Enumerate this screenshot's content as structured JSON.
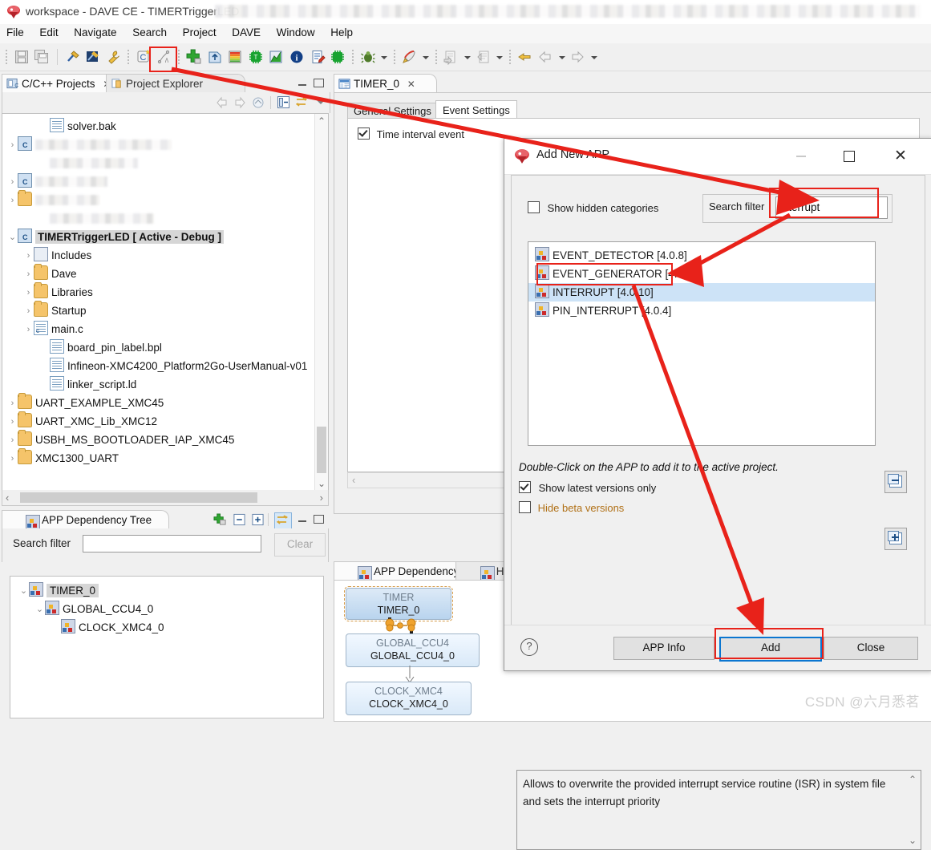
{
  "window": {
    "title": "workspace - DAVE CE - TIMERTriggerLED",
    "app_icon": "dave-icon"
  },
  "menubar": {
    "items": [
      "File",
      "Edit",
      "Navigate",
      "Search",
      "Project",
      "DAVE",
      "Window",
      "Help"
    ]
  },
  "toolbar": {
    "groups": [
      {
        "icons": [
          "save-icon",
          "save-all-icon"
        ]
      },
      {
        "icons": [
          "build-hammer-icon",
          "build-all-icon",
          "wrench-icon"
        ]
      },
      {
        "icons": [
          "new-ce-icon",
          "manual-pin-icon"
        ]
      },
      {
        "icons": [
          "add-new-app-icon",
          "import-app-icon",
          "resource-bar-icon",
          "chip-green-icon",
          "solver-icon",
          "info-icon",
          "report-icon",
          "device-icon"
        ]
      },
      {
        "icons": [
          "debug-bug-icon"
        ],
        "dropdown": true
      },
      {
        "icons": [
          "run-rocket-icon"
        ],
        "dropdown": true
      },
      {
        "icons": [
          "external-tools-icon"
        ],
        "dropdown": true
      },
      {
        "icons": [
          "open-type-icon"
        ],
        "dropdown": true
      },
      {
        "icons": [
          "last-edit-icon"
        ]
      },
      {
        "icons": [
          "back-icon"
        ],
        "dropdown": true
      },
      {
        "icons": [
          "forward-icon"
        ],
        "dropdown": true
      }
    ]
  },
  "projects_view": {
    "tabs": [
      {
        "label": "C/C++ Projects",
        "icon": "cpp-projects-icon",
        "active": true,
        "closable": true
      },
      {
        "label": "Project Explorer",
        "icon": "project-explorer-icon",
        "active": false,
        "closable": false
      }
    ],
    "toolbar_icons": [
      "back-arrow-icon",
      "forward-arrow-icon",
      "home-icon",
      "collapse-all-icon",
      "link-with-editor-icon",
      "view-menu-icon"
    ],
    "view_buttons": [
      "minimize-icon",
      "maximize-icon"
    ],
    "tree": [
      {
        "label": "solver.bak",
        "icon": "file-icon",
        "indent": 2,
        "twisty": "",
        "redacted": false
      },
      {
        "label": "",
        "icon": "project-icon",
        "indent": 0,
        "twisty": "collapsed",
        "redacted": true,
        "blur_width": 170
      },
      {
        "label": "",
        "icon": "none",
        "indent": 1,
        "twisty": "",
        "redacted": true,
        "blur_width": 110
      },
      {
        "label": "",
        "icon": "project-icon",
        "indent": 0,
        "twisty": "collapsed",
        "redacted": true,
        "blur_width": 90
      },
      {
        "label": "",
        "icon": "folder-icon",
        "indent": 0,
        "twisty": "collapsed",
        "redacted": true,
        "blur_width": 80
      },
      {
        "label": "",
        "icon": "none",
        "indent": 1,
        "twisty": "",
        "redacted": true,
        "blur_width": 130
      },
      {
        "label": "TIMERTriggerLED  [ Active - Debug ]",
        "icon": "project-icon",
        "indent": 0,
        "twisty": "expanded",
        "selected": true,
        "bold": true,
        "redacted": false
      },
      {
        "label": "Includes",
        "icon": "includes-icon",
        "indent": 1,
        "twisty": "collapsed"
      },
      {
        "label": "Dave",
        "icon": "folder-icon",
        "indent": 1,
        "twisty": "collapsed"
      },
      {
        "label": "Libraries",
        "icon": "folder-icon",
        "indent": 1,
        "twisty": "collapsed"
      },
      {
        "label": "Startup",
        "icon": "folder-icon",
        "indent": 1,
        "twisty": "collapsed"
      },
      {
        "label": "main.c",
        "icon": "c-file-icon",
        "indent": 1,
        "twisty": "collapsed"
      },
      {
        "label": "board_pin_label.bpl",
        "icon": "file-icon",
        "indent": 2,
        "twisty": ""
      },
      {
        "label": "Infineon-XMC4200_Platform2Go-UserManual-v01",
        "icon": "file-icon",
        "indent": 2,
        "twisty": ""
      },
      {
        "label": "linker_script.ld",
        "icon": "file-icon",
        "indent": 2,
        "twisty": ""
      },
      {
        "label": "UART_EXAMPLE_XMC45",
        "icon": "folder-icon",
        "indent": 0,
        "twisty": "collapsed"
      },
      {
        "label": "UART_XMC_Lib_XMC12",
        "icon": "folder-icon",
        "indent": 0,
        "twisty": "collapsed"
      },
      {
        "label": "USBH_MS_BOOTLOADER_IAP_XMC45",
        "icon": "folder-icon",
        "indent": 0,
        "twisty": "collapsed"
      },
      {
        "label": "XMC1300_UART",
        "icon": "folder-icon",
        "indent": 0,
        "twisty": "collapsed"
      }
    ]
  },
  "dependency_tree_view": {
    "tab_label": "APP Dependency Tree",
    "tab_icon": "app-icon",
    "toolbar_icons": [
      "add-new-app-icon",
      "collapse-all-icon",
      "expand-all-icon",
      "link-with-editor-icon",
      "minimize-icon",
      "maximize-icon"
    ],
    "search_label": "Search filter",
    "search_value": "",
    "search_placeholder": "",
    "clear_label": "Clear",
    "clear_enabled": false,
    "nodes": [
      {
        "label": "TIMER_0",
        "indent": 0,
        "twisty": "expanded",
        "selected": true
      },
      {
        "label": "GLOBAL_CCU4_0",
        "indent": 1,
        "twisty": "expanded",
        "selected": false
      },
      {
        "label": "CLOCK_XMC4_0",
        "indent": 2,
        "twisty": "",
        "selected": false
      }
    ]
  },
  "editor": {
    "tab_label": "TIMER_0",
    "tab_icon": "ce-editor-icon",
    "inner_tabs": [
      {
        "label": "General Settings",
        "active": false
      },
      {
        "label": "Event Settings",
        "active": true
      }
    ],
    "checkbox": {
      "label": "Time interval event",
      "checked": true
    }
  },
  "app_dependency_graph": {
    "tabs": [
      {
        "label": "APP Dependency",
        "icon": "app-icon",
        "active": true,
        "closable": true
      },
      {
        "label": "H",
        "icon": "app-icon",
        "active": false,
        "closable": false
      }
    ],
    "nodes": [
      {
        "type": "TIMER",
        "instance": "TIMER_0",
        "selected": true
      },
      {
        "type": "GLOBAL_CCU4",
        "instance": "GLOBAL_CCU4_0",
        "selected": false
      },
      {
        "type": "CLOCK_XMC4",
        "instance": "CLOCK_XMC4_0",
        "selected": false
      }
    ]
  },
  "dialog": {
    "title": "Add New APP",
    "icon": "dave-icon",
    "window_buttons": [
      "minimize-icon",
      "maximize-icon",
      "close-icon"
    ],
    "show_hidden_categories": {
      "label": "Show hidden categories",
      "checked": false
    },
    "search_filter_label": "Search filter",
    "search_filter_value": "Interrupt",
    "list_items": [
      {
        "label": "EVENT_DETECTOR [4.0.8]",
        "selected": false
      },
      {
        "label": "EVENT_GENERATOR [4.1.16]",
        "selected": false
      },
      {
        "label": "INTERRUPT [4.0.10]",
        "selected": true
      },
      {
        "label": "PIN_INTERRUPT [4.0.4]",
        "selected": false
      }
    ],
    "side_buttons": [
      "collapse-all-icon",
      "expand-all-icon"
    ],
    "hint": "Double-Click on the APP to add it to the active project.",
    "show_latest_versions": {
      "label": "Show latest versions only",
      "checked": true
    },
    "hide_beta_versions": {
      "label": "Hide beta versions",
      "checked": false,
      "color": "#b07016"
    },
    "description": "Allows to overwrite the provided interrupt service routine (ISR) in system file\n and sets the interrupt priority",
    "help_icon": "help-question-icon",
    "buttons": [
      {
        "label": "APP Info",
        "focused": false
      },
      {
        "label": "Add",
        "focused": true
      },
      {
        "label": "Close",
        "focused": false
      }
    ]
  },
  "annotations": {
    "highlight_color": "#e8221a",
    "boxes": [
      "toolbar-add-new-app",
      "search-filter-input",
      "interrupt-list-item",
      "add-button"
    ]
  },
  "watermark": "CSDN @六月悉茗"
}
